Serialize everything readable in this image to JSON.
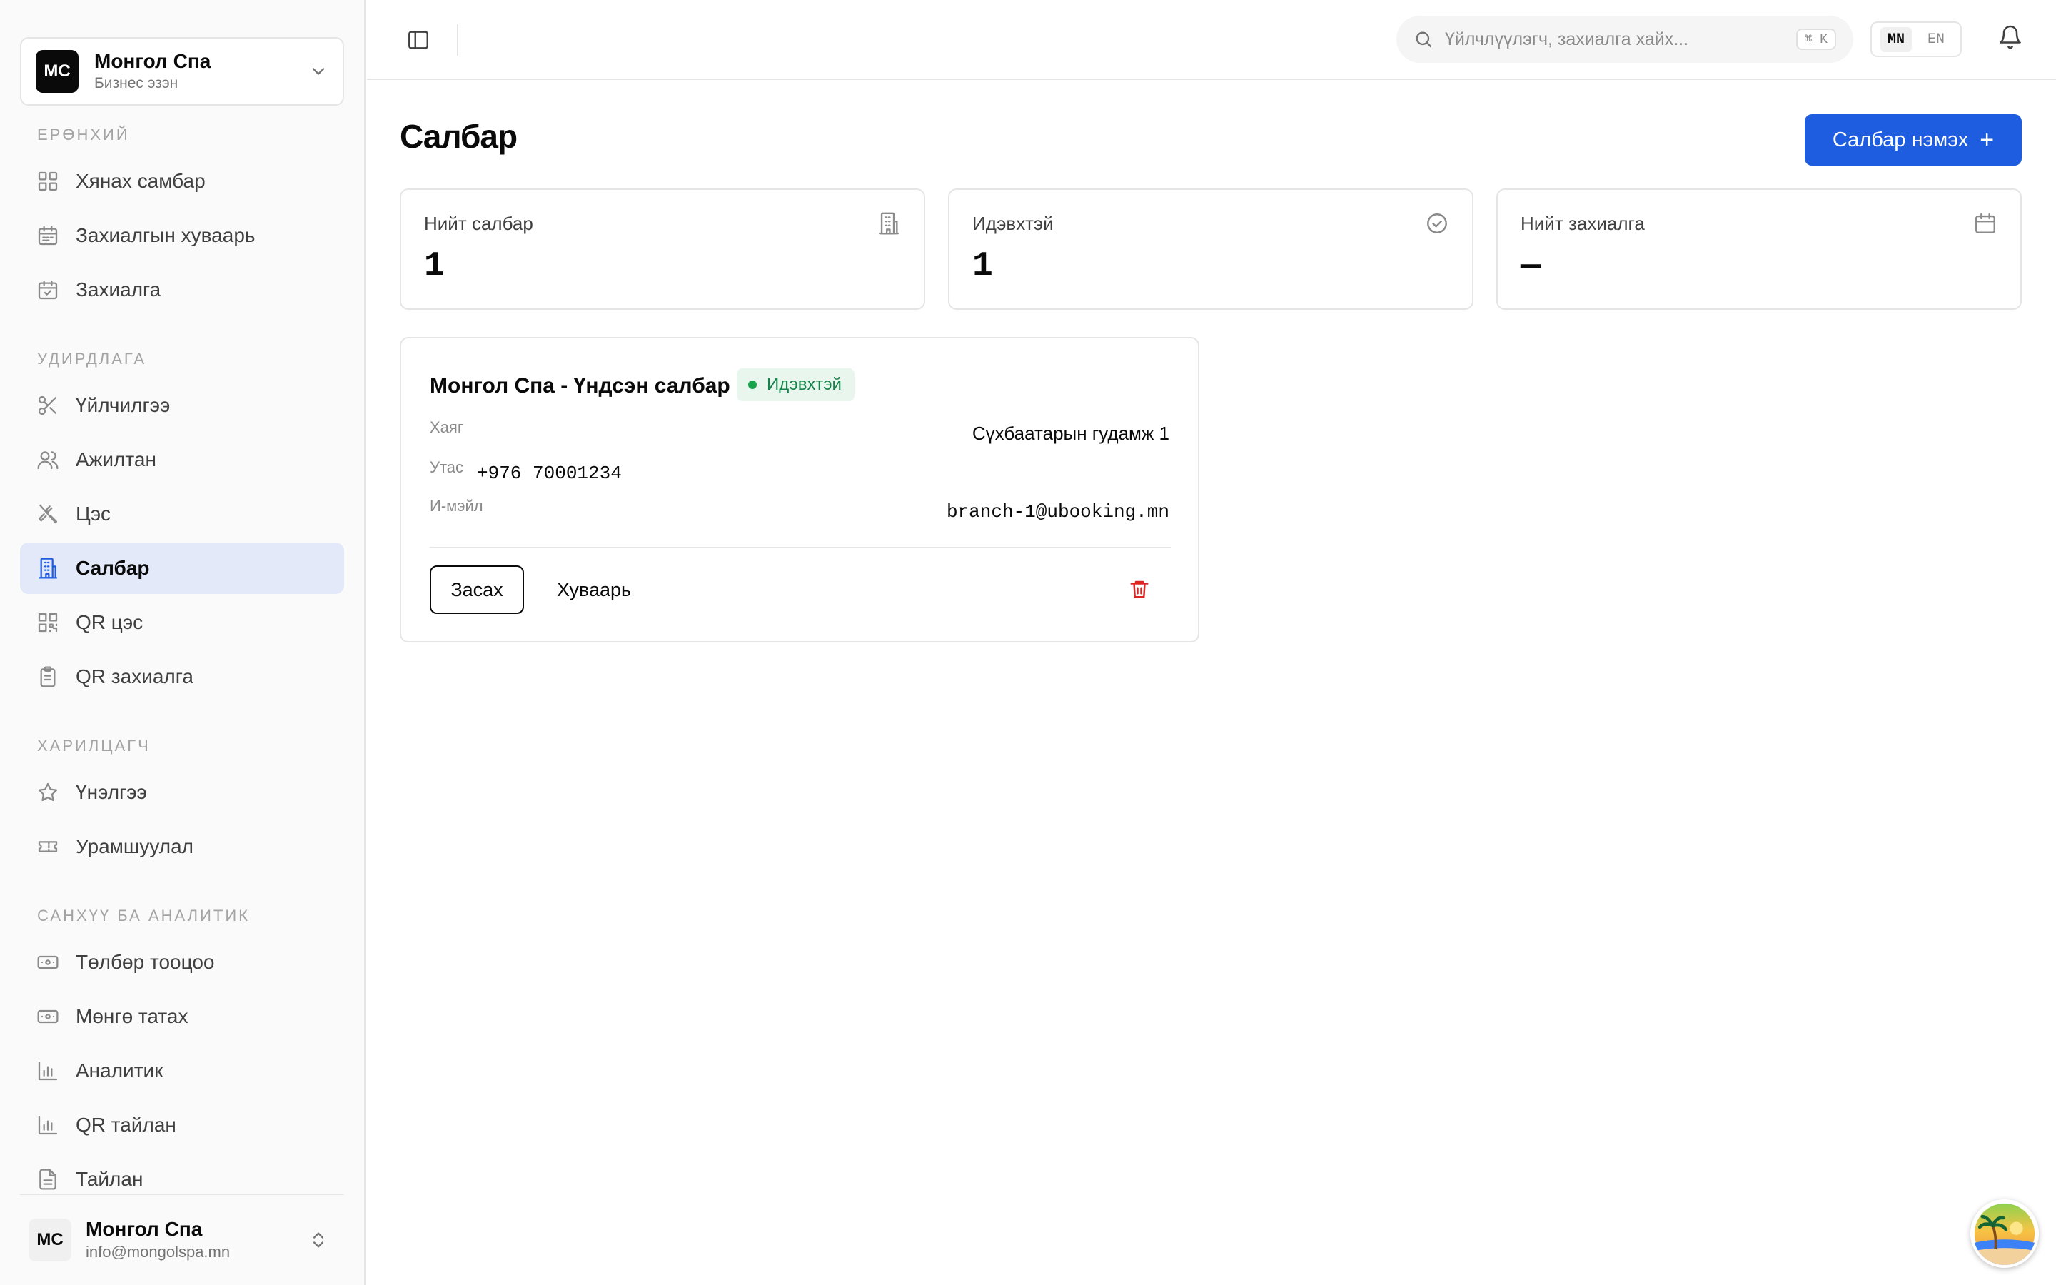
{
  "org": {
    "initials": "MC",
    "name": "Монгол Спа",
    "role": "Бизнес эзэн"
  },
  "sections": {
    "general": "ЕРӨНХИЙ",
    "management": "УДИРДЛАГА",
    "customer": "ХАРИЛЦАГЧ",
    "finance": "САНХҮҮ БА АНАЛИТИК"
  },
  "nav": {
    "dashboard": "Хянах самбар",
    "booking_schedule": "Захиалгын хуваарь",
    "bookings": "Захиалга",
    "services": "Үйлчилгээ",
    "staff": "Ажилтан",
    "menu": "Цэс",
    "branches": "Салбар",
    "qr_menu": "QR цэс",
    "qr_orders": "QR захиалга",
    "reviews": "Үнэлгээ",
    "promotions": "Урамшуулал",
    "payments": "Төлбөр тооцоо",
    "withdrawals": "Мөнгө татах",
    "analytics": "Аналитик",
    "qr_report": "QR тайлан",
    "report": "Тайлан"
  },
  "user": {
    "initials": "MC",
    "name": "Монгол Спа",
    "email": "info@mongolspa.mn"
  },
  "topbar": {
    "search_placeholder": "Үйлчлүүлэгч, захиалга хайх...",
    "shortcut": "⌘ K",
    "lang_mn": "MN",
    "lang_en": "EN"
  },
  "page": {
    "title": "Салбар",
    "add_label": "Салбар нэмэх",
    "add_icon": "+"
  },
  "stats": [
    {
      "label": "Нийт салбар",
      "value": "1",
      "icon": "building-icon"
    },
    {
      "label": "Идэвхтэй",
      "value": "1",
      "icon": "check-circle-icon"
    },
    {
      "label": "Нийт захиалга",
      "value": "—",
      "icon": "calendar-icon"
    }
  ],
  "branch": {
    "name": "Монгол Спа - Үндсэн салбар",
    "status": "Идэвхтэй",
    "address_label": "Хаяг",
    "address": "Сүхбаатарын гудамж 1",
    "phone_label": "Утас",
    "phone": "+976 70001234",
    "email_label": "И-мэйл",
    "email": "branch-1@ubooking.mn",
    "edit_label": "Засах",
    "schedule_label": "Хуваарь"
  },
  "colors": {
    "primary": "#1f5de0",
    "active_bg": "#e3e9f9",
    "success": "#16a34a",
    "danger": "#dc2626"
  }
}
